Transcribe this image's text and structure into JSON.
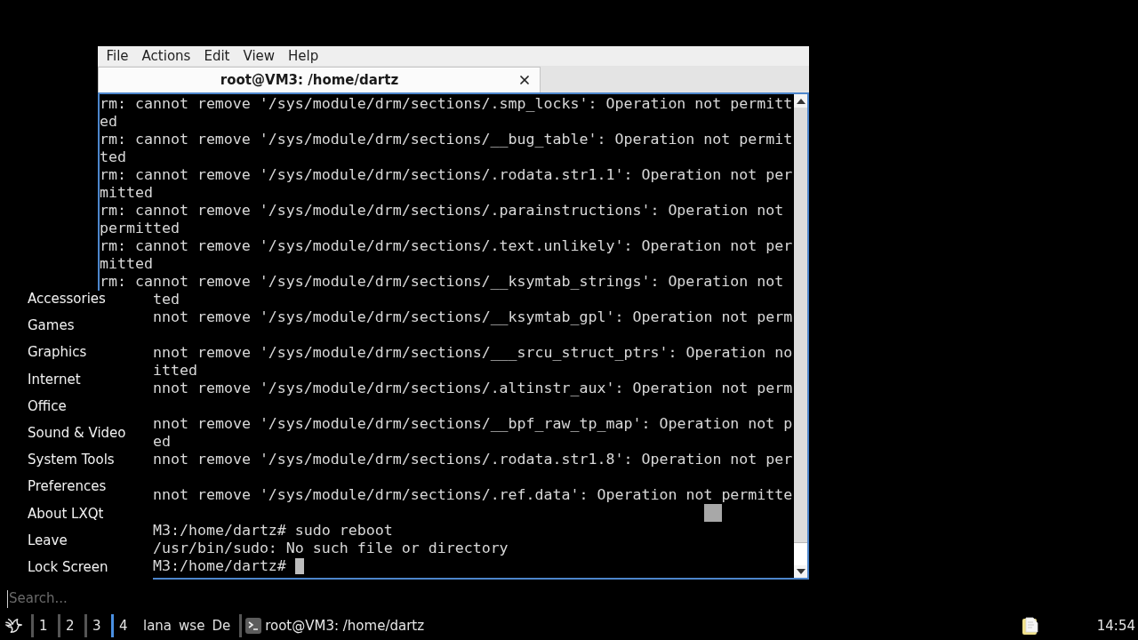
{
  "terminal_window": {
    "menu_bar": [
      "File",
      "Actions",
      "Edit",
      "View",
      "Help"
    ],
    "tabs": [
      {
        "title": "root@VM3: /home/dartz",
        "selected": true
      }
    ],
    "output_rows": [
      "rm: cannot remove '/sys/module/drm/sections/.smp_locks': Operation not permitt",
      "ed",
      "rm: cannot remove '/sys/module/drm/sections/__bug_table': Operation not permit",
      "ted",
      "rm: cannot remove '/sys/module/drm/sections/.rodata.str1.1': Operation not per",
      "mitted",
      "rm: cannot remove '/sys/module/drm/sections/.parainstructions': Operation not",
      "permitted",
      "rm: cannot remove '/sys/module/drm/sections/.text.unlikely': Operation not per",
      "mitted",
      "rm: cannot remove '/sys/module/drm/sections/__ksymtab_strings': Operation not"
    ],
    "rows_beside_menu": [
      {
        "kind": "text",
        "text": "ted"
      },
      {
        "kind": "text",
        "text": "nnot remove '/sys/module/drm/sections/__ksymtab_gpl': Operation not perm"
      },
      {
        "kind": "blank"
      },
      {
        "kind": "text",
        "text": "nnot remove '/sys/module/drm/sections/___srcu_struct_ptrs': Operation no"
      },
      {
        "kind": "text",
        "text": "itted"
      },
      {
        "kind": "text",
        "text": "nnot remove '/sys/module/drm/sections/.altinstr_aux': Operation not perm"
      },
      {
        "kind": "blank"
      },
      {
        "kind": "text",
        "text": "nnot remove '/sys/module/drm/sections/__bpf_raw_tp_map': Operation not p"
      },
      {
        "kind": "text",
        "text": "ed"
      },
      {
        "kind": "text",
        "text": "nnot remove '/sys/module/drm/sections/.rodata.str1.8': Operation not per"
      },
      {
        "kind": "blank"
      },
      {
        "kind": "text",
        "text": "nnot remove '/sys/module/drm/sections/.ref.data': Operation not permitte"
      },
      {
        "kind": "block"
      },
      {
        "kind": "text",
        "text": "M3:/home/dartz# sudo reboot"
      },
      {
        "kind": "text",
        "text": "/usr/bin/sudo: No such file or directory"
      },
      {
        "kind": "prompt",
        "text": "M3:/home/dartz#"
      }
    ]
  },
  "application_menu": {
    "items": [
      "Accessories",
      "Games",
      "Graphics",
      "Internet",
      "Office",
      "Sound & Video",
      "System Tools",
      "Preferences",
      "About LXQt",
      "Leave",
      "Lock Screen"
    ],
    "search": {
      "placeholder": "Search..."
    }
  },
  "taskbar": {
    "desktops": [
      {
        "label": "1",
        "selected": false
      },
      {
        "label": "2",
        "selected": false
      },
      {
        "label": "3",
        "selected": false
      },
      {
        "label": "4",
        "selected": true
      }
    ],
    "items": [
      "lana",
      "wse",
      "De"
    ],
    "tasks": [
      {
        "title": "root@VM3: /home/dartz"
      }
    ],
    "clock": "14:54"
  }
}
